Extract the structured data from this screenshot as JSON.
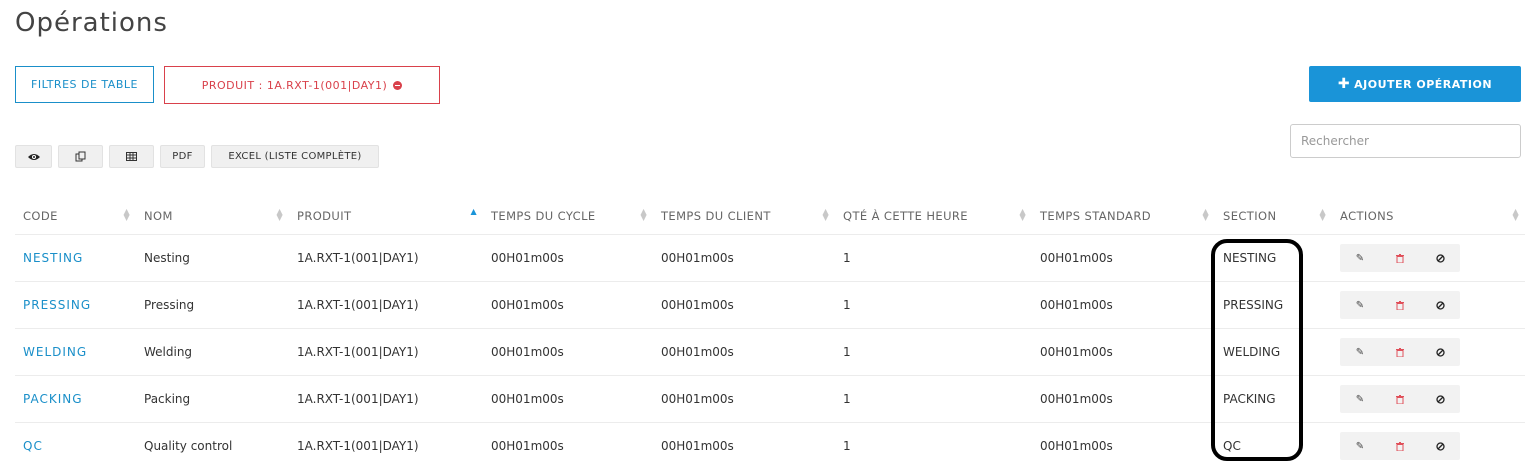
{
  "page": {
    "title": "Opérations"
  },
  "filters": {
    "table_filters_label": "FILTRES DE TABLE",
    "product_filter_label": "PRODUIT : 1A.RXT-1(001|DAY1)"
  },
  "add_button_label": "AJOUTER OPÉRATION",
  "toolbar": {
    "pdf_label": "PDF",
    "excel_label": "EXCEL (LISTE COMPLÈTE)"
  },
  "search": {
    "placeholder": "Rechercher"
  },
  "table": {
    "headers": [
      "CODE",
      "NOM",
      "PRODUIT",
      "TEMPS DU CYCLE",
      "TEMPS DU CLIENT",
      "QTÉ À CETTE HEURE",
      "TEMPS STANDARD",
      "SECTION",
      "ACTIONS"
    ],
    "sorted_column": "PRODUIT",
    "rows": [
      {
        "code": "NESTING",
        "nom": "Nesting",
        "produit": "1A.RXT-1(001|DAY1)",
        "cycle": "00H01m00s",
        "client": "00H01m00s",
        "qte": "1",
        "standard": "00H01m00s",
        "section": "NESTING"
      },
      {
        "code": "PRESSING",
        "nom": "Pressing",
        "produit": "1A.RXT-1(001|DAY1)",
        "cycle": "00H01m00s",
        "client": "00H01m00s",
        "qte": "1",
        "standard": "00H01m00s",
        "section": "PRESSING"
      },
      {
        "code": "WELDING",
        "nom": "Welding",
        "produit": "1A.RXT-1(001|DAY1)",
        "cycle": "00H01m00s",
        "client": "00H01m00s",
        "qte": "1",
        "standard": "00H01m00s",
        "section": "WELDING"
      },
      {
        "code": "PACKING",
        "nom": "Packing",
        "produit": "1A.RXT-1(001|DAY1)",
        "cycle": "00H01m00s",
        "client": "00H01m00s",
        "qte": "1",
        "standard": "00H01m00s",
        "section": "PACKING"
      },
      {
        "code": "QC",
        "nom": "Quality control",
        "produit": "1A.RXT-1(001|DAY1)",
        "cycle": "00H01m00s",
        "client": "00H01m00s",
        "qte": "1",
        "standard": "00H01m00s",
        "section": "QC"
      }
    ]
  },
  "colors": {
    "primary": "#1a94d8",
    "danger": "#d9414b",
    "highlight": "#000000"
  },
  "icons": {
    "view": "eye-icon",
    "copy": "copy-icon",
    "columns": "columns-icon",
    "edit": "edit-icon",
    "delete": "trash-icon",
    "disable": "ban-icon"
  }
}
